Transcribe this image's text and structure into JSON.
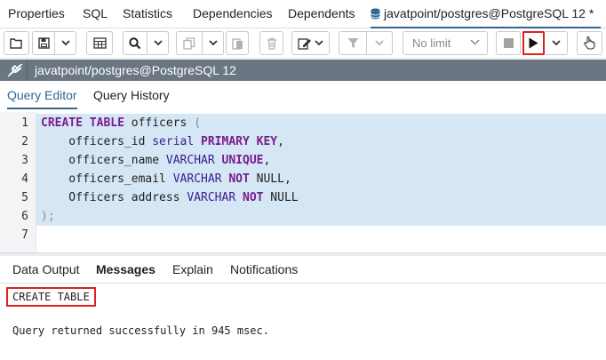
{
  "top_tabs": [
    "Properties",
    "SQL",
    "Statistics",
    "Dependencies",
    "Dependents"
  ],
  "active_tab_title": "javatpoint/postgres@PostgreSQL 12 *",
  "toolbar": {
    "limit_select": "No limit",
    "icons": [
      "open-folder-icon",
      "save-icon",
      "grid-icon",
      "search-icon",
      "copy-icon",
      "paste-icon",
      "delete-icon",
      "edit-icon",
      "filter-icon",
      "stop-icon",
      "execute-icon",
      "hand-icon"
    ]
  },
  "connection": {
    "label": "javatpoint/postgres@PostgreSQL 12"
  },
  "query_tabs": {
    "editor": "Query Editor",
    "history": "Query History"
  },
  "editor": {
    "line_numbers": [
      "1",
      "2",
      "3",
      "4",
      "5",
      "6",
      "7"
    ],
    "lines": [
      [
        {
          "t": "CREATE TABLE",
          "c": "kw"
        },
        {
          "t": " officers ",
          "c": ""
        },
        {
          "t": "(",
          "c": "punc"
        }
      ],
      [
        {
          "t": "    officers_id ",
          "c": ""
        },
        {
          "t": "serial",
          "c": "ty"
        },
        {
          "t": " ",
          "c": ""
        },
        {
          "t": "PRIMARY KEY",
          "c": "kw"
        },
        {
          "t": ",",
          "c": ""
        }
      ],
      [
        {
          "t": "    officers_name ",
          "c": ""
        },
        {
          "t": "VARCHAR",
          "c": "ty"
        },
        {
          "t": " ",
          "c": ""
        },
        {
          "t": "UNIQUE",
          "c": "kw"
        },
        {
          "t": ",",
          "c": ""
        }
      ],
      [
        {
          "t": "    officers_email ",
          "c": ""
        },
        {
          "t": "VARCHAR",
          "c": "ty"
        },
        {
          "t": " ",
          "c": ""
        },
        {
          "t": "NOT",
          "c": "kw"
        },
        {
          "t": " NULL,",
          "c": ""
        }
      ],
      [
        {
          "t": "    Officers address ",
          "c": ""
        },
        {
          "t": "VARCHAR",
          "c": "ty"
        },
        {
          "t": " ",
          "c": ""
        },
        {
          "t": "NOT",
          "c": "kw"
        },
        {
          "t": " NULL",
          "c": ""
        }
      ],
      [
        {
          "t": ");",
          "c": "punc"
        }
      ],
      []
    ]
  },
  "output_tabs": [
    "Data Output",
    "Messages",
    "Explain",
    "Notifications"
  ],
  "output_active": "Messages",
  "messages": {
    "result": "CREATE TABLE",
    "status": "Query returned successfully in 945 msec."
  },
  "colors": {
    "accent": "#326690",
    "highlight": "#e02020",
    "selection": "#d5e7f5",
    "keyword": "#7a1c8c",
    "type": "#3a1c94",
    "connbar": "#6b7683"
  }
}
